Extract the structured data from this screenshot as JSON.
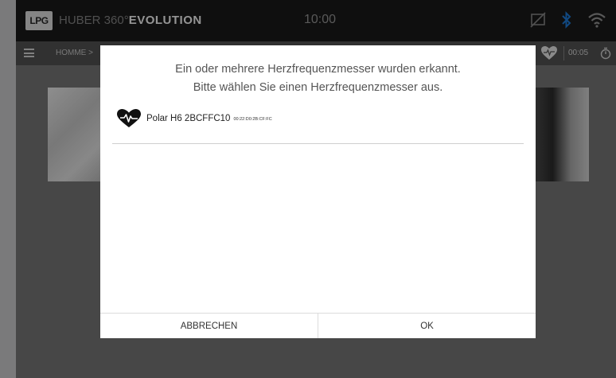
{
  "statusbar": {
    "logo": "LPG",
    "brand_light": "HUBER 360°",
    "brand_bold": "EVOLUTION",
    "time": "10:00",
    "icons": [
      "screen-off-icon",
      "bluetooth-icon",
      "wifi-icon"
    ],
    "bluetooth_color": "#1e7fe0"
  },
  "navbar": {
    "breadcrumb": "HOMME >",
    "timer": "00:05"
  },
  "dialog": {
    "message_line1": "Ein oder mehrere Herzfrequenzmesser wurden erkannt.",
    "message_line2": "Bitte wählen Sie einen Herzfrequenzmesser aus.",
    "devices": [
      {
        "name": "Polar H6 2BCFFC10",
        "address": "00:22:D0:2B:CF:FC",
        "icon": "heart-rate-icon"
      }
    ],
    "cancel_label": "ABBRECHEN",
    "ok_label": "OK"
  }
}
